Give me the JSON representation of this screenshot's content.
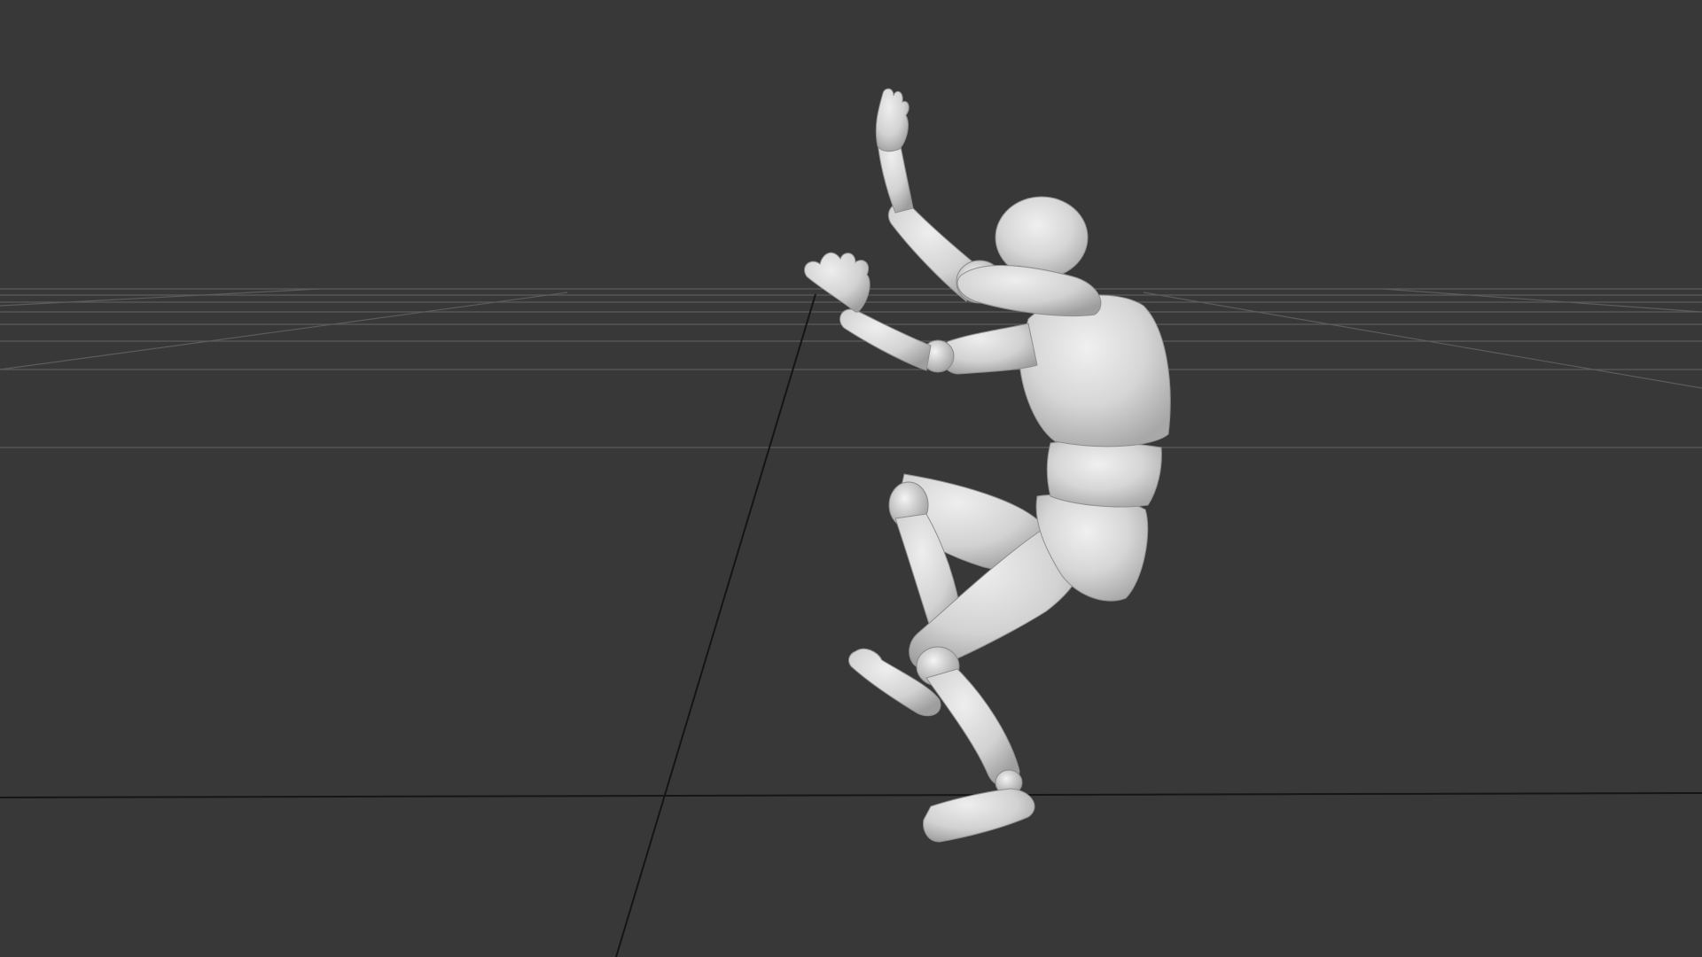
{
  "viewport": {
    "background_color": "#383838",
    "grid_color": "#5a5a5a",
    "axis_color": "#161616",
    "model_color": "#d9d9d9",
    "model_shadow_color": "#9a9a9a",
    "model_highlight_color": "#efefef"
  },
  "scene": {
    "subject": "mannequin-figure",
    "grid": "floor-grid"
  }
}
